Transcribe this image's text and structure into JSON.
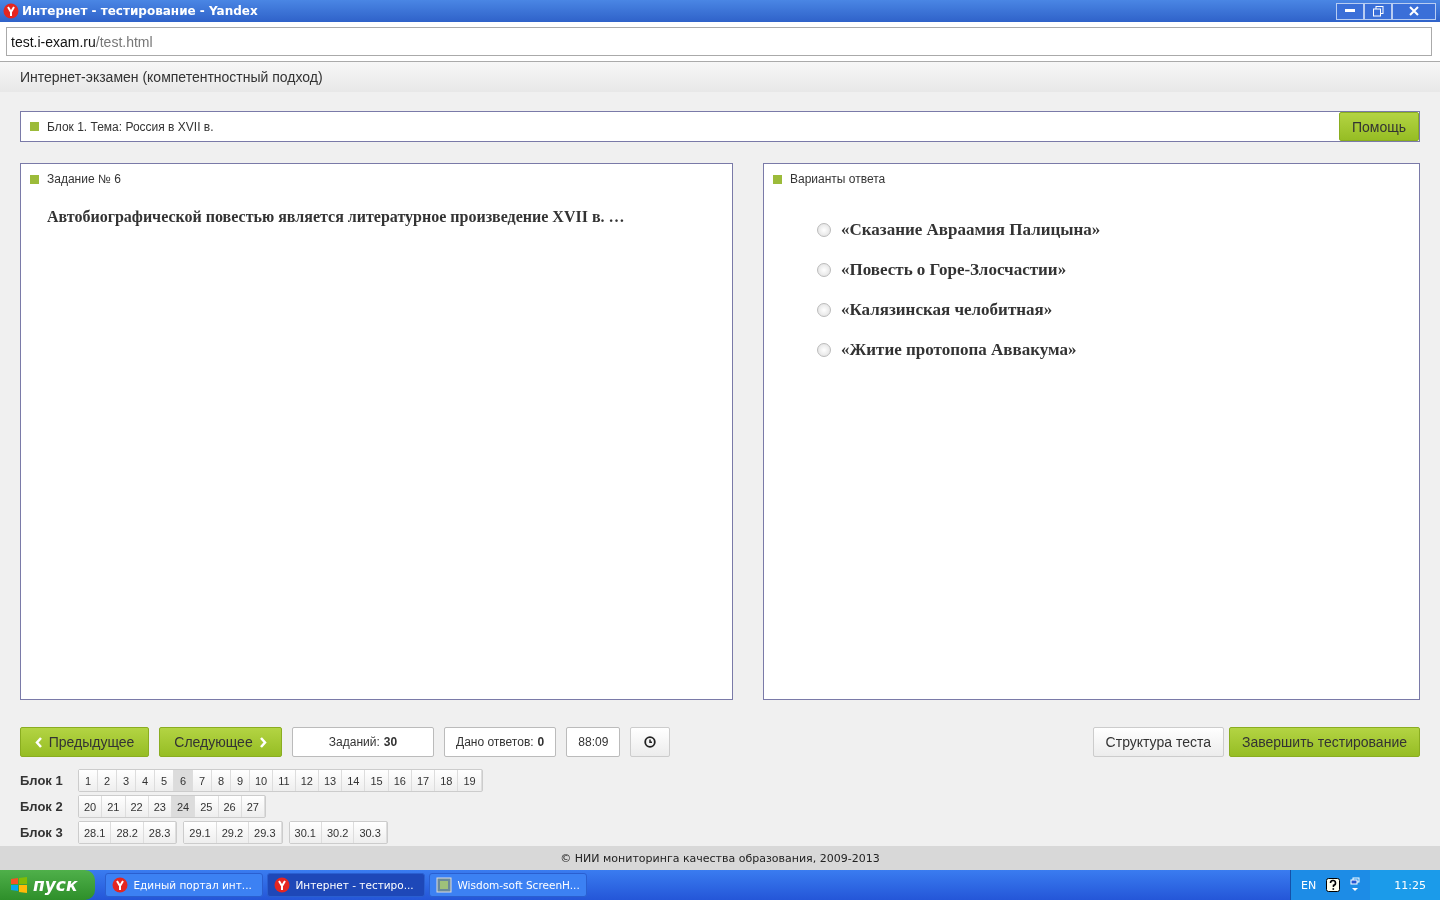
{
  "window": {
    "title": "Интернет - тестирование - Yandex"
  },
  "address": {
    "host": "test.i-exam.ru",
    "path": "/test.html"
  },
  "app_title": "Интернет-экзамен (компетентностный подход)",
  "topic": "Блок 1. Тема: Россия в XVII в.",
  "help_button": "Помощь",
  "task": {
    "heading": "Задание № 6",
    "text": "Автобиографической повестью является литературное произведение XVII в. …"
  },
  "answers": {
    "heading": "Варианты ответа",
    "options": [
      {
        "label": "«Сказание Авраамия Палицына»",
        "selected": false
      },
      {
        "label": "«Повесть о Горе-Злосчастии»",
        "selected": false
      },
      {
        "label": "«Калязинская челобитная»",
        "selected": false
      },
      {
        "label": "«Житие протопопа Аввакума»",
        "selected": false
      }
    ]
  },
  "controls": {
    "prev": "Предыдущее",
    "next": "Следующее",
    "tasks_label": "Заданий:",
    "tasks_count": "30",
    "answered_label": "Дано ответов:",
    "answered_count": "0",
    "timer": "88:09",
    "structure": "Структура теста",
    "finish": "Завершить тестирование"
  },
  "blocks": [
    {
      "label": "Блок 1",
      "groups": [
        {
          "items": [
            {
              "label": "1",
              "selected": false
            },
            {
              "label": "2",
              "selected": false
            },
            {
              "label": "3",
              "selected": false
            },
            {
              "label": "4",
              "selected": false
            },
            {
              "label": "5",
              "selected": false
            },
            {
              "label": "6",
              "selected": true
            },
            {
              "label": "7",
              "selected": false
            },
            {
              "label": "8",
              "selected": false
            },
            {
              "label": "9",
              "selected": false
            },
            {
              "label": "10",
              "selected": false
            },
            {
              "label": "11",
              "selected": false
            },
            {
              "label": "12",
              "selected": false
            },
            {
              "label": "13",
              "selected": false
            },
            {
              "label": "14",
              "selected": false
            },
            {
              "label": "15",
              "selected": false
            },
            {
              "label": "16",
              "selected": false
            },
            {
              "label": "17",
              "selected": false
            },
            {
              "label": "18",
              "selected": false
            },
            {
              "label": "19",
              "selected": false
            }
          ]
        }
      ]
    },
    {
      "label": "Блок 2",
      "groups": [
        {
          "items": [
            {
              "label": "20",
              "selected": false
            },
            {
              "label": "21",
              "selected": false
            },
            {
              "label": "22",
              "selected": false
            },
            {
              "label": "23",
              "selected": false
            },
            {
              "label": "24",
              "selected": true
            },
            {
              "label": "25",
              "selected": false
            },
            {
              "label": "26",
              "selected": false
            },
            {
              "label": "27",
              "selected": false
            }
          ]
        }
      ]
    },
    {
      "label": "Блок 3",
      "groups": [
        {
          "items": [
            {
              "label": "28.1",
              "selected": false
            },
            {
              "label": "28.2",
              "selected": false
            },
            {
              "label": "28.3",
              "selected": false
            }
          ]
        },
        {
          "items": [
            {
              "label": "29.1",
              "selected": false
            },
            {
              "label": "29.2",
              "selected": false
            },
            {
              "label": "29.3",
              "selected": false
            }
          ]
        },
        {
          "items": [
            {
              "label": "30.1",
              "selected": false
            },
            {
              "label": "30.2",
              "selected": false
            },
            {
              "label": "30.3",
              "selected": false
            }
          ]
        }
      ]
    }
  ],
  "footer": "© НИИ мониторинга качества образования, 2009-2013",
  "taskbar": {
    "start": "пуск",
    "tasks": [
      {
        "label": "Единый портал инт...",
        "kind": "browser",
        "selected": false
      },
      {
        "label": "Интернет - тестиро...",
        "kind": "browser",
        "selected": true
      },
      {
        "label": "Wisdom-soft ScreenH...",
        "kind": "app",
        "selected": false
      }
    ],
    "lang": "EN",
    "clock": "11:25"
  }
}
